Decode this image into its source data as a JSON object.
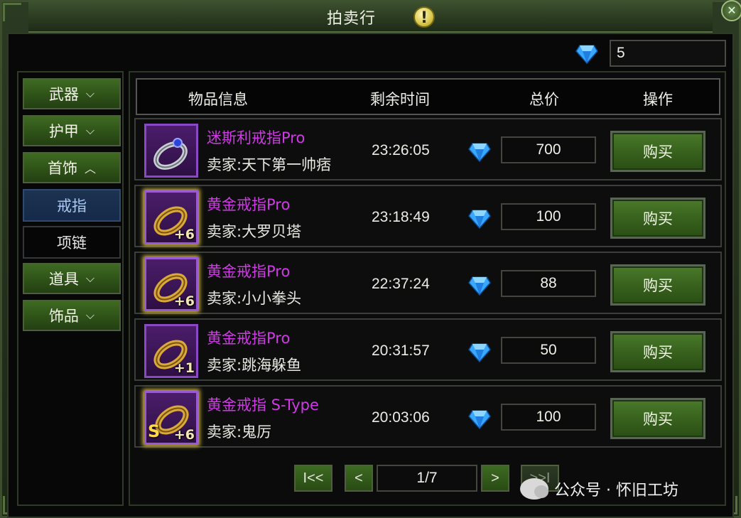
{
  "window": {
    "title": "拍卖行",
    "info_icon": "exclamation-icon"
  },
  "currency": {
    "icon": "diamond-icon",
    "amount": "5"
  },
  "sidebar": {
    "categories": [
      {
        "label": "武器",
        "expanded": false
      },
      {
        "label": "护甲",
        "expanded": false
      },
      {
        "label": "首饰",
        "expanded": true
      },
      {
        "label": "道具",
        "expanded": false
      },
      {
        "label": "饰品",
        "expanded": false
      }
    ],
    "subcategories": [
      {
        "label": "戒指",
        "active": true
      },
      {
        "label": "项链",
        "active": false
      }
    ]
  },
  "table": {
    "headers": {
      "item_info": "物品信息",
      "time_left": "剩余时间",
      "total_price": "总价",
      "action": "操作"
    },
    "rows": [
      {
        "name": "迷斯利戒指Pro",
        "seller": "卖家:天下第一帅痞",
        "time": "23:26:05",
        "price": "700",
        "buy": "购买",
        "enhance": "",
        "icon": "silver-sapphire-ring-icon"
      },
      {
        "name": "黄金戒指Pro",
        "seller": "卖家:大罗贝塔",
        "time": "23:18:49",
        "price": "100",
        "buy": "购买",
        "enhance": "+6",
        "icon": "gold-ring-icon"
      },
      {
        "name": "黄金戒指Pro",
        "seller": "卖家:小小拳头",
        "time": "22:37:24",
        "price": "88",
        "buy": "购买",
        "enhance": "+6",
        "icon": "gold-ring-icon"
      },
      {
        "name": "黄金戒指Pro",
        "seller": "卖家:跳海躲鱼",
        "time": "20:31:57",
        "price": "50",
        "buy": "购买",
        "enhance": "+1",
        "icon": "gold-ring-icon"
      },
      {
        "name": "黄金戒指 S-Type",
        "seller": "卖家:鬼厉",
        "time": "20:03:06",
        "price": "100",
        "buy": "购买",
        "enhance": "+6",
        "stype": "S",
        "icon": "gold-ring-icon"
      }
    ]
  },
  "pagination": {
    "first": "I<<",
    "prev": "<",
    "page": "1/7",
    "next": ">",
    "last": ">>I"
  },
  "watermark": {
    "text": "公众号 · 怀旧工坊"
  },
  "colors": {
    "item_name": "#d03ae6",
    "button_green": "#38621e",
    "active_sub": "#1c3350",
    "rarity_border": "#8a48c4"
  }
}
